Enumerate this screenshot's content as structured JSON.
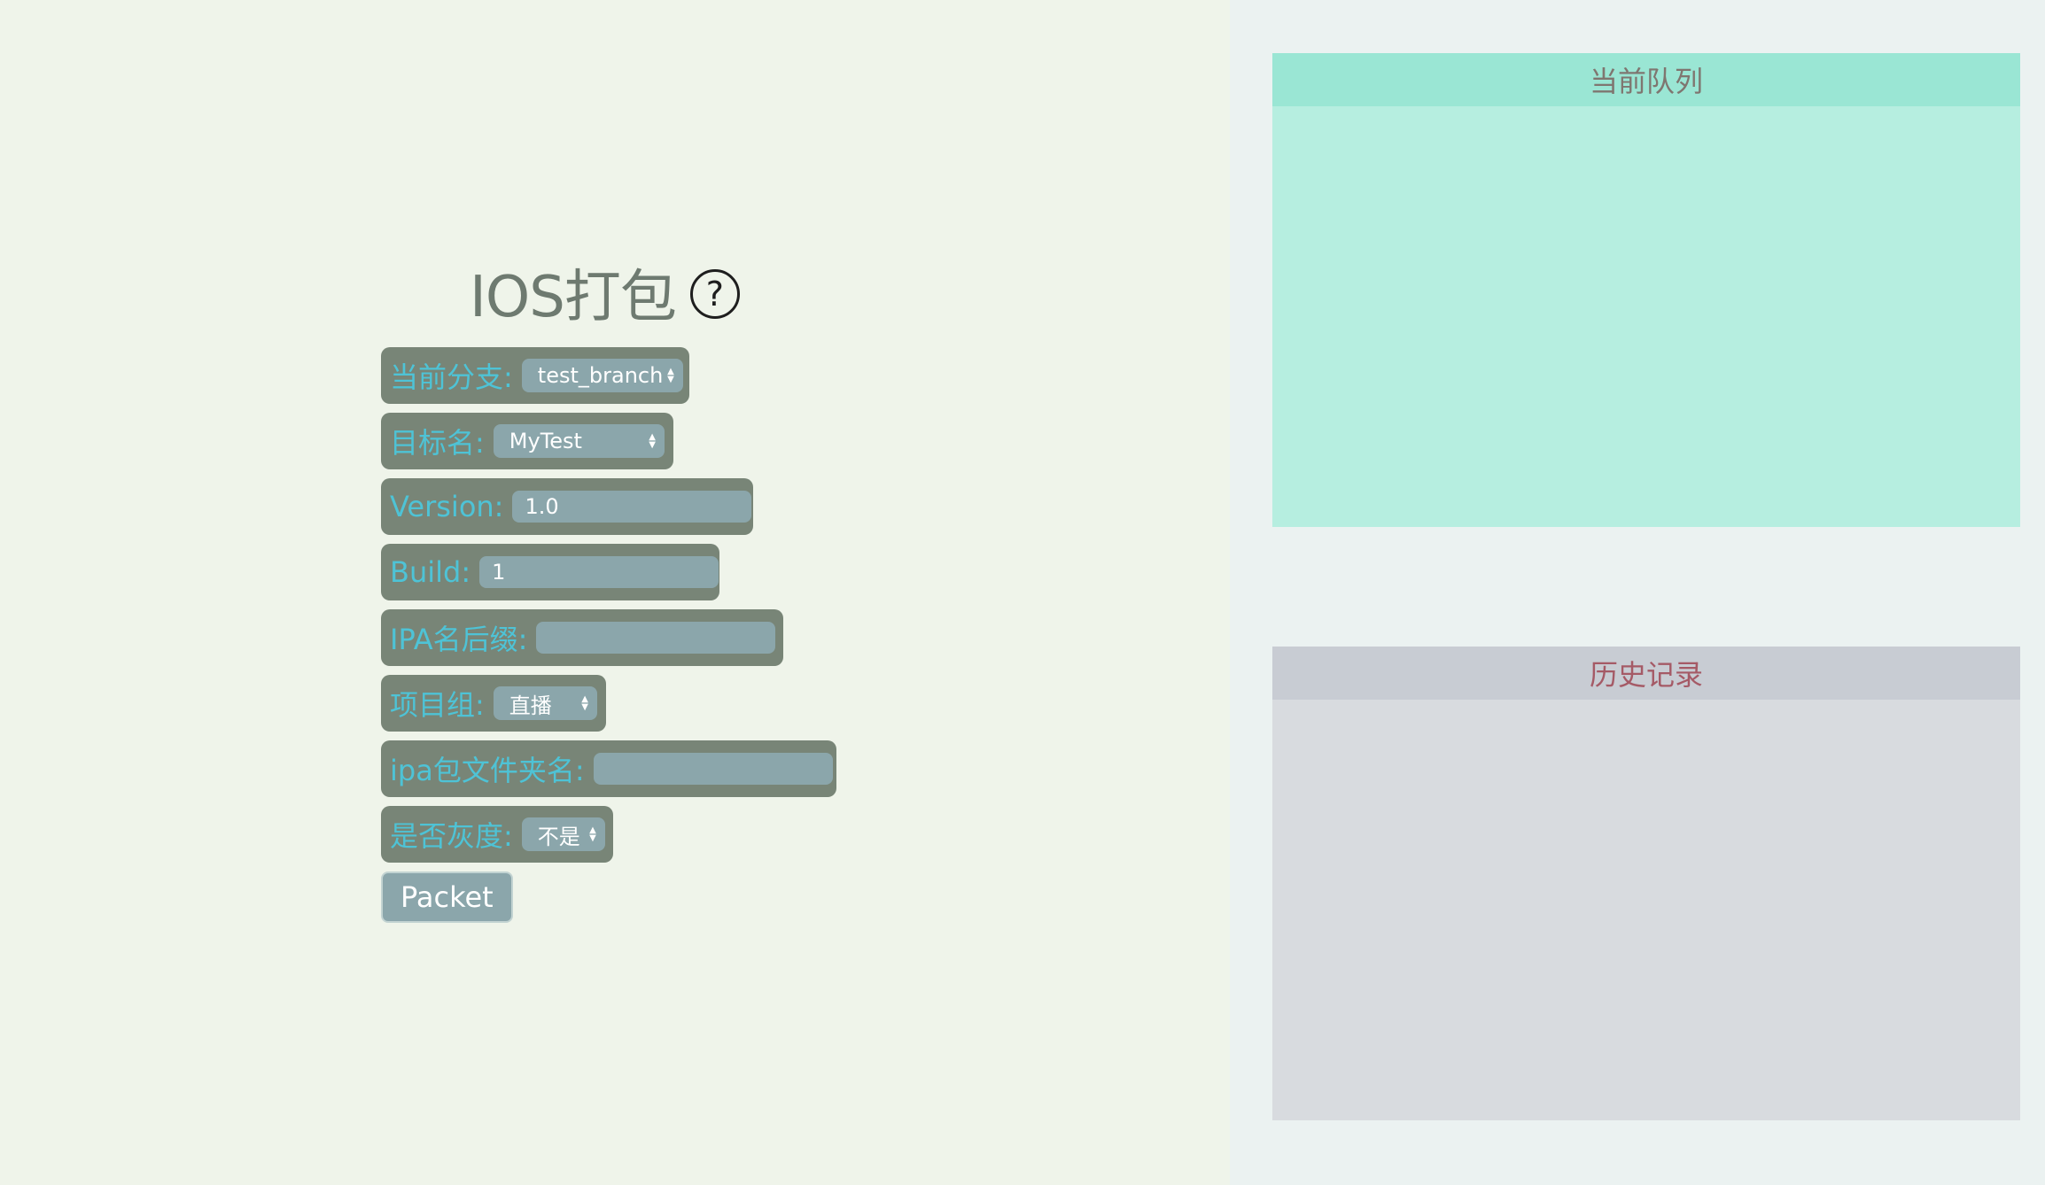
{
  "title": "IOS打包",
  "help_icon": "?",
  "form": {
    "branch": {
      "label": "当前分支:",
      "value": "test_branch"
    },
    "target": {
      "label": "目标名:",
      "value": "MyTest"
    },
    "version": {
      "label": "Version:",
      "value": "1.0"
    },
    "build": {
      "label": "Build:",
      "value": "1"
    },
    "ipa_suffix": {
      "label": "IPA名后缀:",
      "value": ""
    },
    "project_group": {
      "label": "项目组:",
      "value": "直播"
    },
    "ipa_folder": {
      "label": "ipa包文件夹名:",
      "value": ""
    },
    "gray": {
      "label": "是否灰度:",
      "value": "不是"
    }
  },
  "packet_button": "Packet",
  "queue": {
    "title": "当前队列"
  },
  "history": {
    "title": "历史记录"
  }
}
